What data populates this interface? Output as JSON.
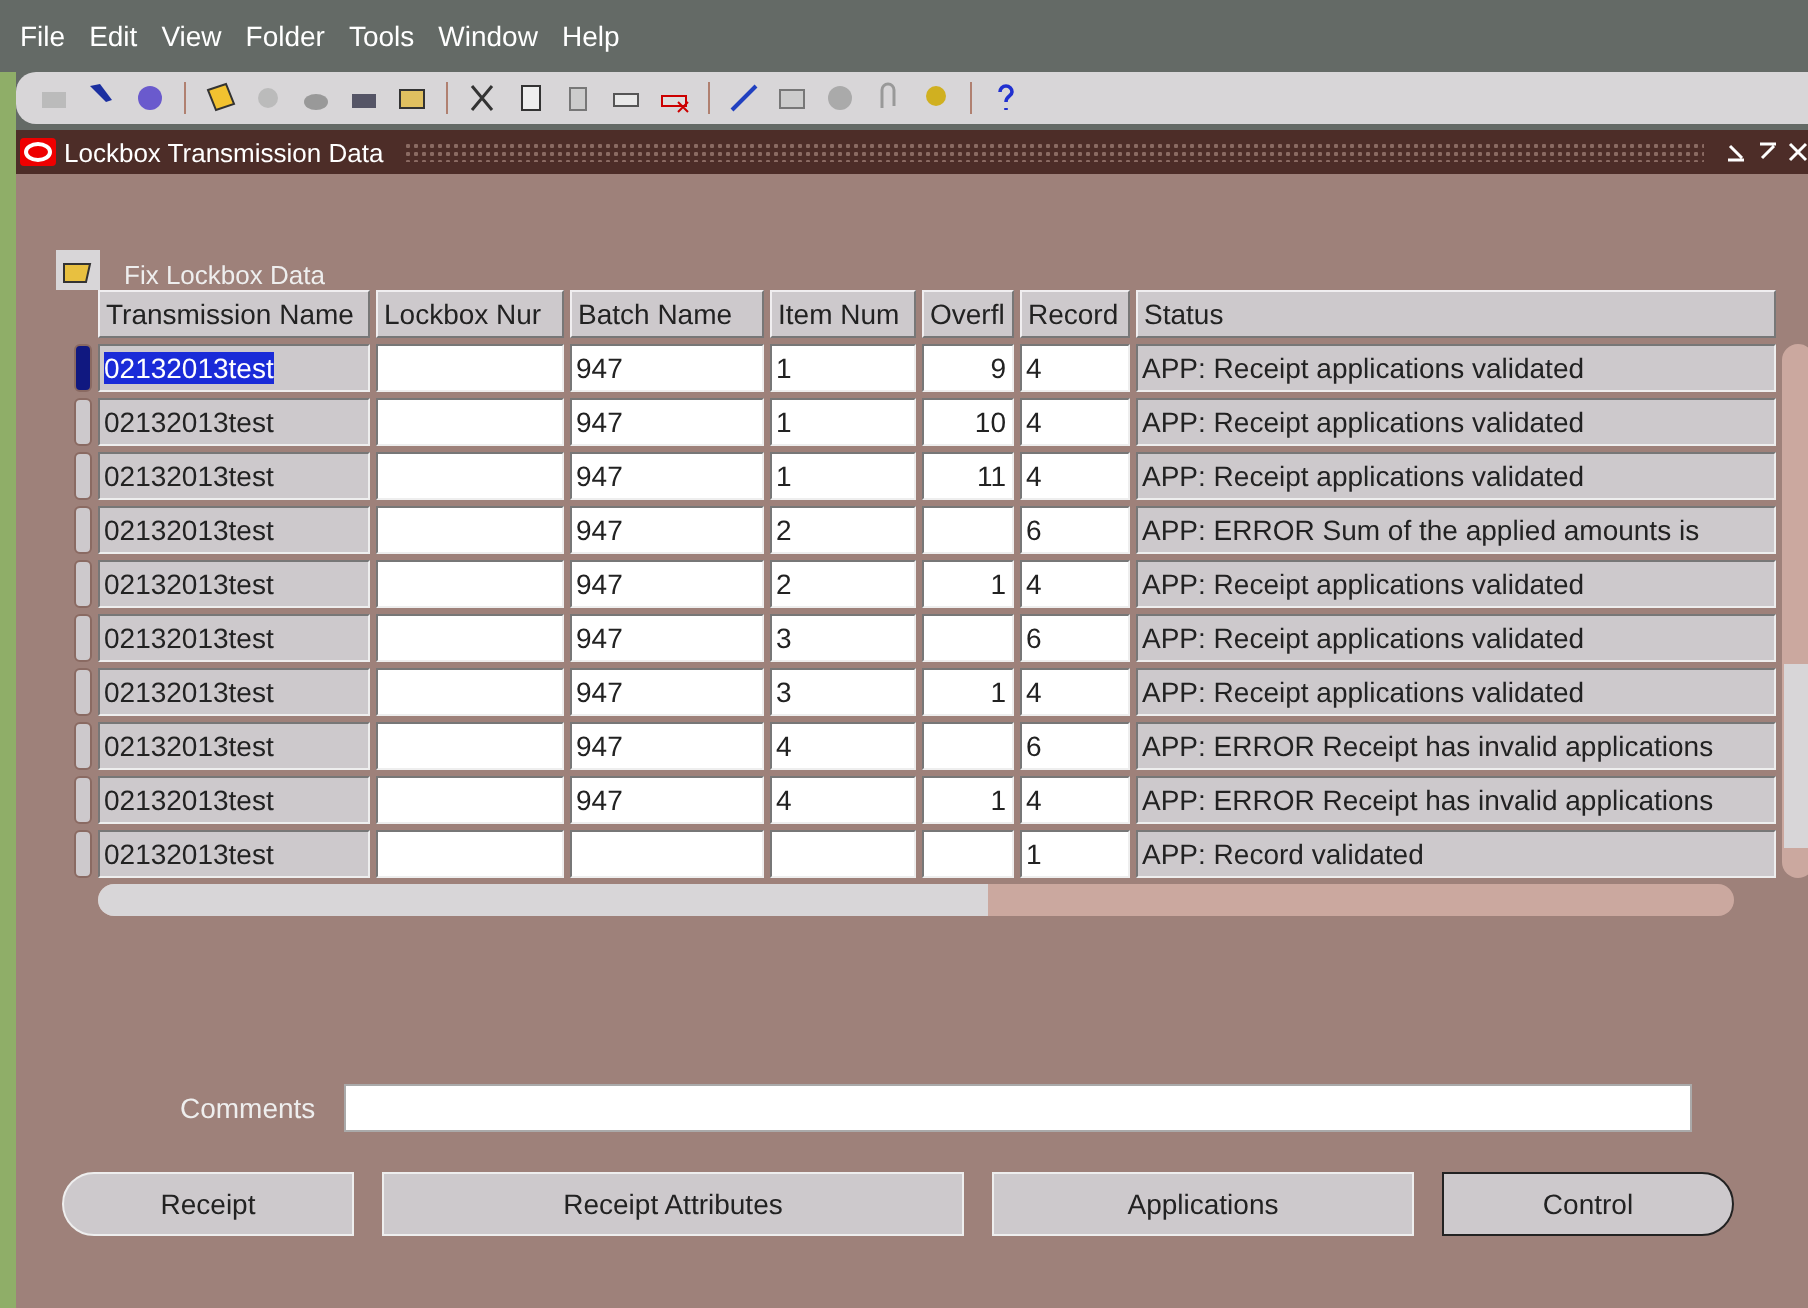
{
  "menu": [
    "File",
    "Edit",
    "View",
    "Folder",
    "Tools",
    "Window",
    "Help"
  ],
  "window": {
    "title": "Lockbox Transmission Data"
  },
  "folder": {
    "title": "Fix Lockbox Data"
  },
  "table": {
    "columns": [
      "Transmission Name",
      "Lockbox Nur",
      "Batch Name",
      "Item Num",
      "Overfl",
      "Record",
      "Status"
    ],
    "rows": [
      {
        "selected": true,
        "cells": [
          "02132013test",
          "",
          "947",
          "1",
          "9",
          "4",
          "APP: Receipt applications validated"
        ]
      },
      {
        "selected": false,
        "cells": [
          "02132013test",
          "",
          "947",
          "1",
          "10",
          "4",
          "APP: Receipt applications validated"
        ]
      },
      {
        "selected": false,
        "cells": [
          "02132013test",
          "",
          "947",
          "1",
          "11",
          "4",
          "APP: Receipt applications validated"
        ]
      },
      {
        "selected": false,
        "cells": [
          "02132013test",
          "",
          "947",
          "2",
          "",
          "6",
          "APP: ERROR Sum of the applied amounts is"
        ]
      },
      {
        "selected": false,
        "cells": [
          "02132013test",
          "",
          "947",
          "2",
          "1",
          "4",
          "APP: Receipt applications validated"
        ]
      },
      {
        "selected": false,
        "cells": [
          "02132013test",
          "",
          "947",
          "3",
          "",
          "6",
          "APP: Receipt applications validated"
        ]
      },
      {
        "selected": false,
        "cells": [
          "02132013test",
          "",
          "947",
          "3",
          "1",
          "4",
          "APP: Receipt applications validated"
        ]
      },
      {
        "selected": false,
        "cells": [
          "02132013test",
          "",
          "947",
          "4",
          "",
          "6",
          "APP: ERROR Receipt has invalid applications"
        ]
      },
      {
        "selected": false,
        "cells": [
          "02132013test",
          "",
          "947",
          "4",
          "1",
          "4",
          "APP: ERROR Receipt has invalid applications"
        ]
      },
      {
        "selected": false,
        "cells": [
          "02132013test",
          "",
          "",
          "",
          "",
          "1",
          "APP: Record validated"
        ]
      }
    ]
  },
  "comments": {
    "label": "Comments"
  },
  "buttons": [
    {
      "label": "Receipt",
      "kind": "first"
    },
    {
      "label": "Receipt Attributes",
      "kind": "middle"
    },
    {
      "label": "Applications",
      "kind": "middle"
    },
    {
      "label": "Control",
      "kind": "last"
    }
  ]
}
